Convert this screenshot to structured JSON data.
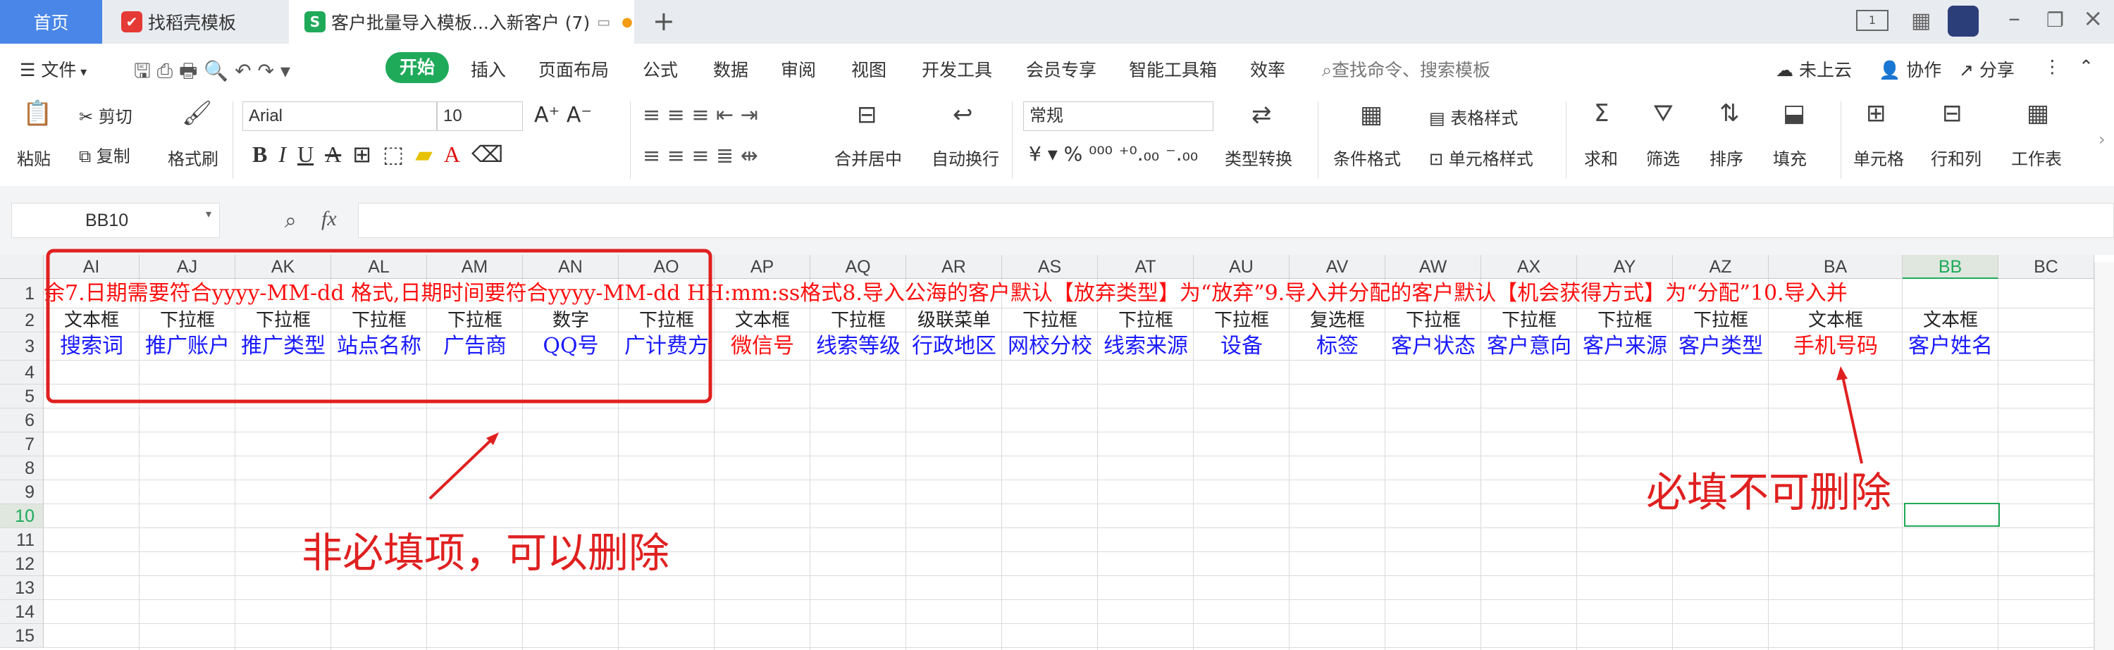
{
  "tabs": {
    "home": "首页",
    "templates": "找稻壳模板",
    "document": "客户批量导入模板...入新客户 (7)"
  },
  "menu": {
    "file": "文件",
    "start": "开始",
    "items": [
      "插入",
      "页面布局",
      "公式",
      "数据",
      "审阅",
      "视图",
      "开发工具",
      "会员专享",
      "智能工具箱",
      "效率"
    ],
    "search_placeholder": "查找命令、搜索模板",
    "cloud": "未上云",
    "collab": "协作",
    "share": "分享"
  },
  "ribbon": {
    "paste": "粘贴",
    "cut": "剪切",
    "copy": "复制",
    "format_painter": "格式刷",
    "font_name": "Arial",
    "font_size": "10",
    "merge_center": "合并居中",
    "wrap_text": "自动换行",
    "number_format": "常规",
    "type_convert": "类型转换",
    "cond_format": "条件格式",
    "table_style": "表格样式",
    "cell_style": "单元格样式",
    "sum": "求和",
    "filter": "筛选",
    "sort": "排序",
    "fill": "填充",
    "cell": "单元格",
    "row_col": "行和列",
    "worksheet": "工作表"
  },
  "formula_bar": {
    "name_box": "BB10",
    "fx": "fx",
    "value": ""
  },
  "sheet": {
    "columns": [
      "AI",
      "AJ",
      "AK",
      "AL",
      "AM",
      "AN",
      "AO",
      "AP",
      "AQ",
      "AR",
      "AS",
      "AT",
      "AU",
      "AV",
      "AW",
      "AX",
      "AY",
      "AZ",
      "BA",
      "BB",
      "BC"
    ],
    "rows": [
      "1",
      "2",
      "3",
      "4",
      "5",
      "6",
      "7",
      "8",
      "9",
      "10",
      "11",
      "12",
      "13",
      "14",
      "15"
    ],
    "row1_text": "余7.日期需要符合yyyy-MM-dd 格式,日期时间要符合yyyy-MM-dd HH:mm:ss格式8.导入公海的客户默认【放弃类型】为“放弃”9.导入并分配的客户默认【机会获得方式】为“分配”10.导入并",
    "row2": [
      "文本框",
      "下拉框",
      "下拉框",
      "下拉框",
      "下拉框",
      "数字",
      "下拉框",
      "文本框",
      "下拉框",
      "级联菜单",
      "下拉框",
      "下拉框",
      "下拉框",
      "复选框",
      "下拉框",
      "下拉框",
      "下拉框",
      "下拉框",
      "文本框",
      "文本框",
      ""
    ],
    "row3": [
      "搜索词",
      "推广账户",
      "推广类型",
      "站点名称",
      "广告商",
      "QQ号",
      "广计费方",
      "微信号",
      "线索等级",
      "行政地区",
      "网校分校",
      "线索来源",
      "设备",
      "标签",
      "客户状态",
      "客户意向",
      "客户来源",
      "客户类型",
      "手机号码",
      "客户姓名",
      ""
    ],
    "row3_colors": [
      "blue",
      "blue",
      "blue",
      "blue",
      "blue",
      "blue",
      "blue",
      "red",
      "blue",
      "blue",
      "blue",
      "blue",
      "blue",
      "blue",
      "blue",
      "blue",
      "blue",
      "blue",
      "red",
      "blue",
      "blue"
    ]
  },
  "annotations": {
    "optional": "非必填项，可以删除",
    "required": "必填不可删除"
  },
  "colors": {
    "start_button": "#1faa5a",
    "home_tab": "#4a86e8",
    "annotation": "#e02020",
    "selection": "#1faa5a"
  }
}
